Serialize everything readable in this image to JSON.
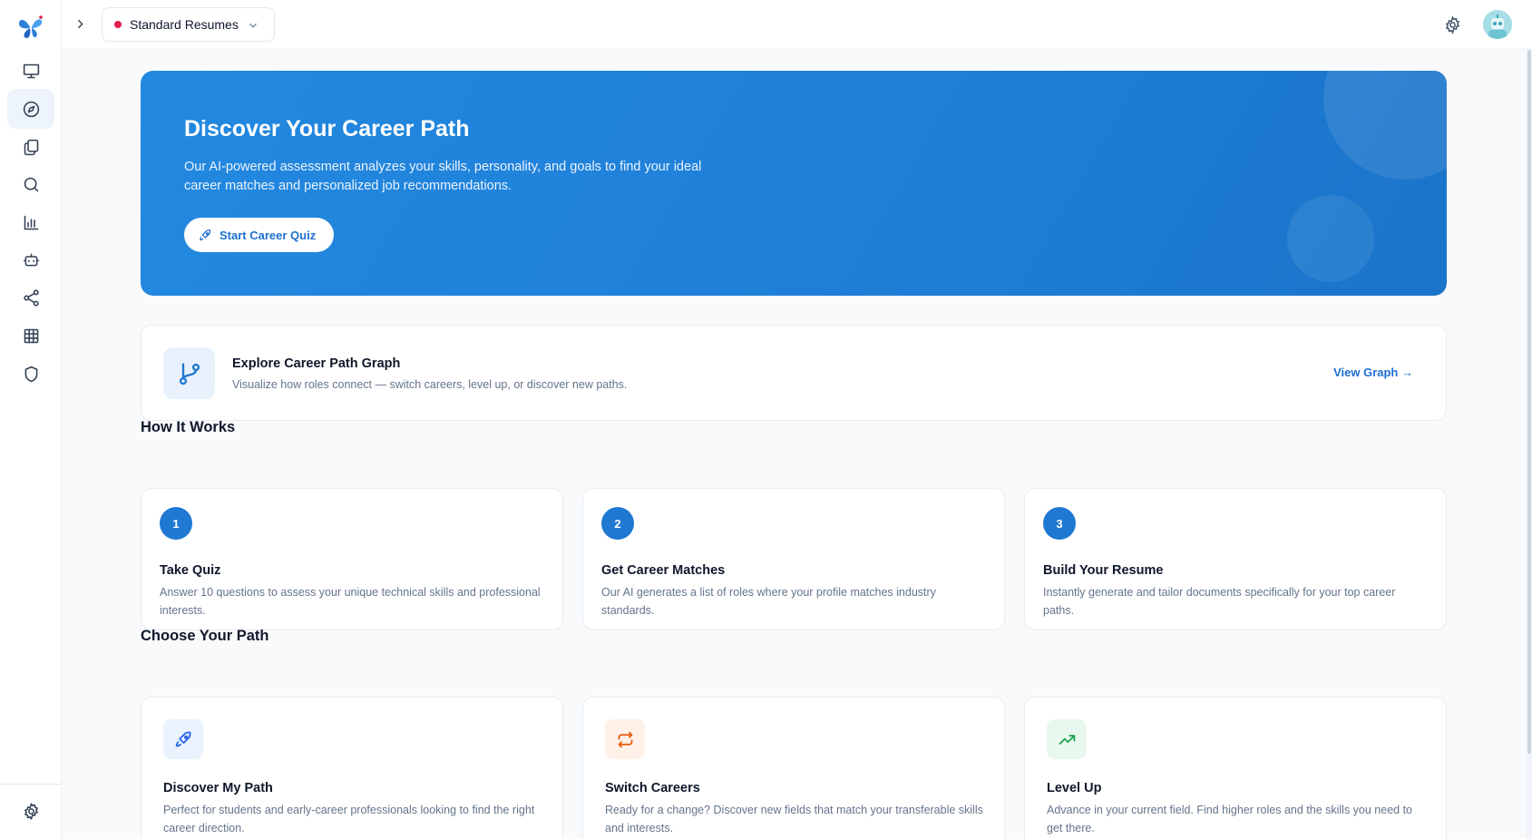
{
  "app": {
    "selector_label": "Standard Resumes"
  },
  "sidebar": {
    "items": [
      {
        "icon": "presentation-icon",
        "active": false
      },
      {
        "icon": "compass-icon",
        "active": true
      },
      {
        "icon": "documents-icon",
        "active": false
      },
      {
        "icon": "search-icon",
        "active": false
      },
      {
        "icon": "bar-chart-icon",
        "active": false
      },
      {
        "icon": "bot-icon",
        "active": false
      },
      {
        "icon": "share-icon",
        "active": false
      },
      {
        "icon": "grid-icon",
        "active": false
      },
      {
        "icon": "shield-icon",
        "active": false
      }
    ],
    "footer_icon": "settings-icon"
  },
  "hero": {
    "title": "Discover Your Career Path",
    "description": "Our AI-powered assessment analyzes your skills, personality, and goals to find your ideal career matches and personalized job recommendations.",
    "button_label": "Start Career Quiz"
  },
  "graph_card": {
    "title": "Explore Career Path Graph",
    "description": "Visualize how roles connect — switch careers, level up, or discover new paths.",
    "link_label": "View Graph →"
  },
  "how_it_works": {
    "title": "How It Works",
    "steps": [
      {
        "number": "1",
        "title": "Take Quiz",
        "description": "Answer 10 questions to assess your unique technical skills and professional interests."
      },
      {
        "number": "2",
        "title": "Get Career Matches",
        "description": "Our AI generates a list of roles where your profile matches industry standards."
      },
      {
        "number": "3",
        "title": "Build Your Resume",
        "description": "Instantly generate and tailor documents specifically for your top career paths."
      }
    ]
  },
  "choose_path": {
    "title": "Choose Your Path",
    "paths": [
      {
        "title": "Discover My Path",
        "description": "Perfect for students and early-career professionals looking to find the right career direction.",
        "icon": "rocket-icon",
        "color": "#2563eb",
        "bg": "#eaf2fd"
      },
      {
        "title": "Switch Careers",
        "description": "Ready for a change? Discover new fields that match your transferable skills and interests.",
        "icon": "switch-arrows-icon",
        "color": "#ea580c",
        "bg": "#fff1e8"
      },
      {
        "title": "Level Up",
        "description": "Advance in your current field. Find higher roles and the skills you need to get there.",
        "icon": "trending-up-icon",
        "color": "#16a34a",
        "bg": "#e9f8ee"
      }
    ]
  },
  "colors": {
    "accent": "#1f78d1",
    "hero_gradient_start": "#2389e0",
    "hero_gradient_end": "#1a74c9",
    "status_dot": "#e11d48"
  }
}
